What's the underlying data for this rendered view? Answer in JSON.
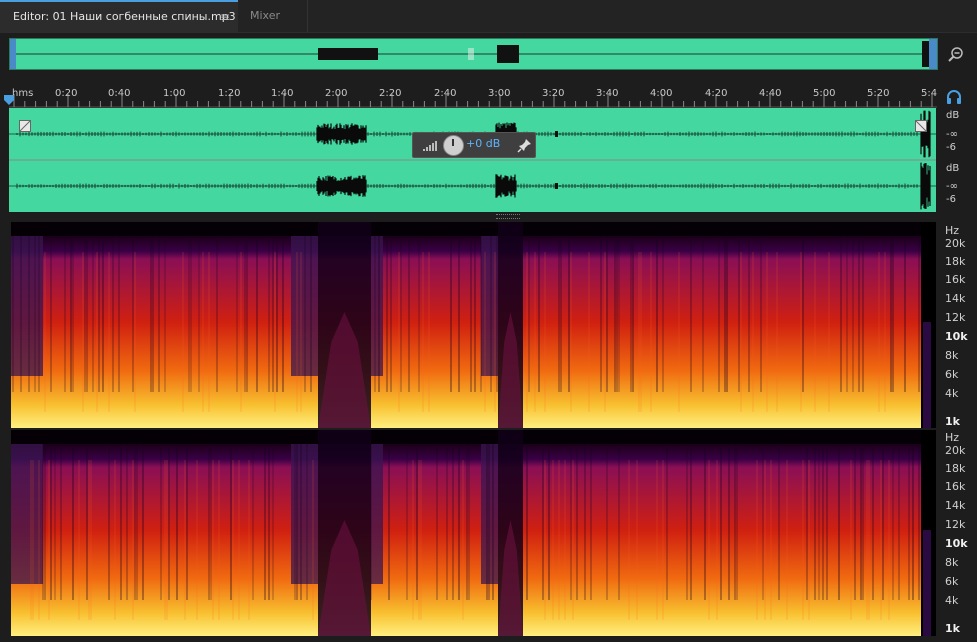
{
  "tabs": {
    "editor_label": "Editor: 01 Наши согбенные спины.mp3",
    "editor_menu": "≡",
    "mixer_label": "Mixer"
  },
  "ruler": {
    "format_label": "hms",
    "ticks": [
      "0:20",
      "0:40",
      "1:00",
      "1:20",
      "1:40",
      "2:00",
      "2:20",
      "2:40",
      "3:00",
      "3:20",
      "3:40",
      "4:00",
      "4:20",
      "4:40",
      "5:00",
      "5:20",
      "5:4"
    ]
  },
  "hud": {
    "value": "+0 dB"
  },
  "amplitude_scale": {
    "channel_1": [
      "dB",
      "-∞",
      "-6"
    ],
    "channel_2": [
      "dB",
      "-∞",
      "-6"
    ]
  },
  "frequency_scale": {
    "unit": "Hz",
    "labels": [
      "20k",
      "18k",
      "16k",
      "14k",
      "12k",
      "10k",
      "8k",
      "6k",
      "4k",
      "1k"
    ]
  },
  "colors": {
    "waveform_bg": "#44d8a0",
    "accent": "#4a9fe0",
    "hud_value": "#5fb4ff"
  }
}
